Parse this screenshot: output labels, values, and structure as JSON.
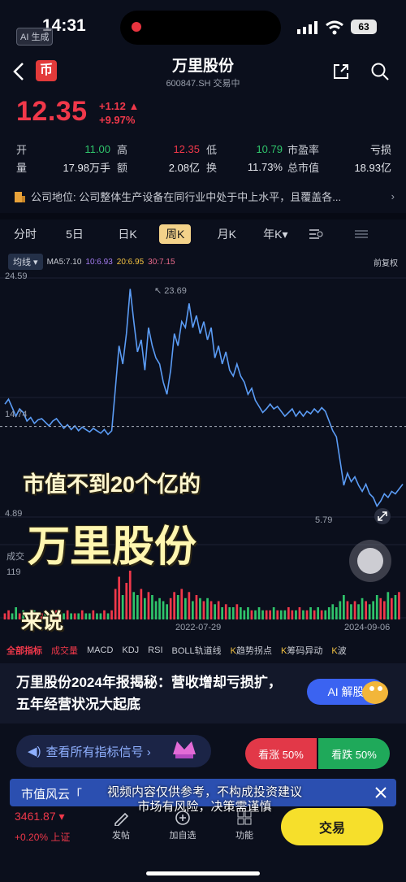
{
  "status": {
    "time": "14:31",
    "ai_badge": "AI 生成",
    "battery": "63"
  },
  "header": {
    "title": "万里股份",
    "code": "600847.SH",
    "trade_state": "交易中",
    "logo_char": "币"
  },
  "quote": {
    "price": "12.35",
    "change": "+1.12",
    "change_pct": "+9.97%",
    "rows": [
      {
        "k1": "开",
        "v1": "11.00",
        "k2": "高",
        "v2": "12.35",
        "k3": "低",
        "v3": "10.79",
        "k4": "市盈率",
        "v4": "亏损"
      },
      {
        "k1": "量",
        "v1": "17.98万手",
        "k2": "额",
        "v2": "2.08亿",
        "k3": "换",
        "v3": "11.73%",
        "k4": "总市值",
        "v4": "18.93亿"
      }
    ]
  },
  "company": {
    "text": "公司地位: 公司整体生产设备在同行业中处于中上水平，且覆盖各..."
  },
  "chart_tabs": [
    "分时",
    "5日",
    "日K",
    "周K",
    "月K",
    "年K▾"
  ],
  "ma": {
    "selector": "均线 ▾",
    "ma5": "MA5:7.10",
    "ma10": "10:6.93",
    "ma20": "20:6.95",
    "ma30": "30:7.15",
    "adjust": "前复权"
  },
  "chart_data": {
    "type": "line",
    "x_labels": [
      "2022-07-29",
      "2024-09-06"
    ],
    "y_ticks": [
      "24.59",
      "14.74",
      "4.89"
    ],
    "max_label": "23.69",
    "min_label": "5.79",
    "ylim": [
      4.89,
      24.59
    ],
    "values": [
      14.2,
      14.6,
      13.9,
      13.2,
      13.8,
      13.5,
      12.8,
      13.1,
      12.6,
      12.9,
      13.0,
      12.7,
      12.4,
      12.8,
      13.0,
      12.6,
      12.2,
      12.5,
      12.1,
      12.4,
      12.0,
      12.3,
      12.1,
      11.9,
      12.2,
      12.0,
      11.8,
      12.1,
      11.7,
      12.0,
      15.5,
      19.0,
      17.5,
      20.0,
      23.69,
      21.0,
      18.5,
      19.5,
      17.0,
      20.5,
      19.0,
      18.0,
      17.5,
      16.0,
      15.0,
      17.0,
      20.0,
      19.0,
      21.0,
      20.5,
      22.5,
      20.5,
      21.5,
      20.0,
      21.0,
      19.5,
      20.5,
      18.0,
      19.0,
      17.5,
      18.5,
      17.0,
      16.5,
      17.5,
      16.5,
      16.0,
      15.0,
      15.5,
      14.5,
      14.0,
      13.5,
      13.8,
      14.2,
      13.8,
      14.0,
      13.6,
      13.2,
      13.5,
      13.8,
      13.2,
      13.6,
      13.2,
      13.6,
      13.4,
      13.8,
      13.5,
      13.9,
      13.6,
      12.8,
      12.0,
      11.5,
      9.5,
      7.5,
      8.5,
      7.8,
      8.2,
      7.5,
      7.0,
      7.6,
      6.8,
      6.5,
      5.79,
      6.2,
      6.8,
      6.5,
      7.0,
      6.8,
      7.2,
      7.6
    ],
    "volume": [
      2,
      3,
      2,
      4,
      2,
      3,
      2,
      2,
      3,
      2,
      2,
      3,
      2,
      2,
      3,
      2,
      2,
      3,
      2,
      2,
      2,
      3,
      2,
      2,
      3,
      2,
      2,
      3,
      2,
      3,
      10,
      14,
      8,
      12,
      16,
      9,
      8,
      10,
      7,
      9,
      8,
      6,
      7,
      6,
      5,
      7,
      9,
      8,
      10,
      7,
      9,
      6,
      8,
      7,
      6,
      7,
      6,
      5,
      6,
      4,
      5,
      4,
      4,
      5,
      4,
      3,
      4,
      3,
      3,
      4,
      3,
      3,
      3,
      4,
      3,
      3,
      3,
      4,
      3,
      3,
      4,
      3,
      3,
      4,
      3,
      4,
      3,
      3,
      4,
      5,
      4,
      6,
      8,
      6,
      5,
      6,
      5,
      7,
      6,
      5,
      6,
      8,
      7,
      6,
      9,
      7,
      8,
      9
    ]
  },
  "chart_labels": {
    "volume": "成交",
    "vol_tick": "119"
  },
  "captions": {
    "line1": "市值不到20个亿的",
    "line2": "万里股份",
    "line3": "来说"
  },
  "indicators": [
    "全部指标",
    "成交量",
    "MACD",
    "KDJ",
    "RSI",
    "BOLL轨道线",
    "趋势拐点",
    "筹码异动",
    "波"
  ],
  "news": {
    "headline": "万里股份2024年报揭秘：营收增却亏损扩，五年经营状况大起底",
    "ai_button": "AI 解股"
  },
  "signal": {
    "label": "查看所有指标信号 ›"
  },
  "vote": {
    "up": "看涨 50%",
    "down": "看跌 50%"
  },
  "banner": {
    "left": "市值风云「",
    "overlay1": "视频内容仅供参考，不构成投资建议",
    "overlay2": "市场有风险，决策需谨慎"
  },
  "bottom": {
    "index_value": "3461.87 ▾",
    "index_change": "+0.20% 上证",
    "nav": [
      {
        "label": "发帖"
      },
      {
        "label": "加自选"
      },
      {
        "label": "功能"
      }
    ],
    "trade": "交易"
  },
  "colors": {
    "up": "#f0384a",
    "down": "#2fc46b",
    "line": "#5b9cf5",
    "accent": "#f6df2b"
  }
}
